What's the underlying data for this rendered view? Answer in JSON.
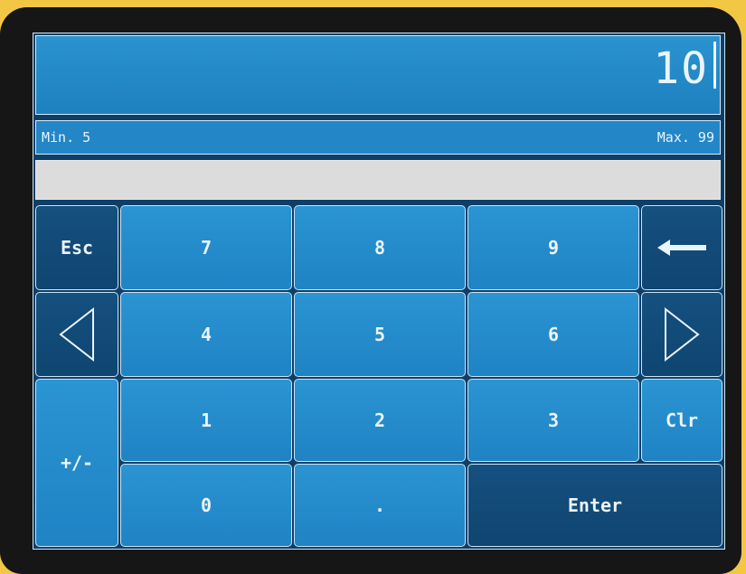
{
  "display": {
    "value": "10"
  },
  "limits": {
    "min_label": "Min. 5",
    "max_label": "Max. 99"
  },
  "keys": {
    "esc": "Esc",
    "seven": "7",
    "eight": "8",
    "nine": "9",
    "backspace_icon": "left-arrow-icon",
    "left_icon": "triangle-left-icon",
    "four": "4",
    "five": "5",
    "six": "6",
    "right_icon": "triangle-right-icon",
    "plus_minus": "+/-",
    "one": "1",
    "two": "2",
    "three": "3",
    "clr": "Clr",
    "zero": "0",
    "dot": ".",
    "enter": "Enter"
  },
  "colors": {
    "key_blue": "#2390cf",
    "key_dark": "#13507f",
    "background": "#0e3f68",
    "bezel": "#161616",
    "frame": "#f2c744"
  }
}
